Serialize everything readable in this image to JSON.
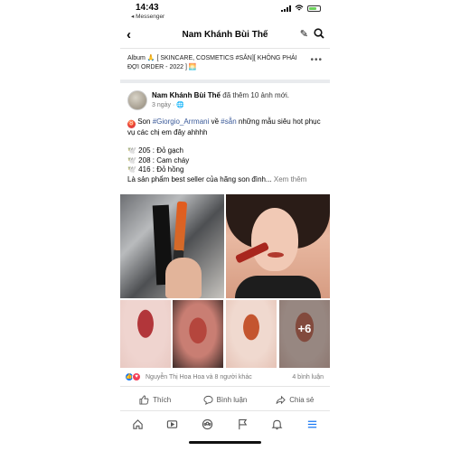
{
  "status": {
    "time": "14:43",
    "back_app": "◂ Messenger"
  },
  "topbar": {
    "title": "Nam Khánh Bùi Thế"
  },
  "album": {
    "text": "Album 🙏 [ SKINCARE, COSMETICS #SẴN][ KHÔNG PHẢI ĐỢI ORDER - 2022 ] 🌅"
  },
  "post": {
    "author": "Nam Khánh Bùi Thế",
    "action": " đã thêm 10 ảnh mới.",
    "time": "3 ngày · ",
    "line1_prefix": " Son ",
    "tag1": "#Giorgio_Arrmani",
    "line1_mid": " về ",
    "tag2": "#sẵn",
    "line1_suffix": " những mẫu siêu hot phục vụ các chị em đây ahhhh",
    "shade1": "🕊️ 205 : Đỏ gạch",
    "shade2": "🕊️ 208 : Cam cháy",
    "shade3": "🕊️ 416 : Đỏ hồng",
    "summary": "Là sản phẩm best seller của hãng son đình... ",
    "see_more": "Xem thêm",
    "more_photos": "+6"
  },
  "reactions": {
    "names": "Nguyễn Thị Hoa Hoa và 8 người khác",
    "comments": "4 bình luận"
  },
  "actions": {
    "like": "Thích",
    "comment": "Bình luận",
    "share": "Chia sẻ"
  },
  "colors": {
    "accent": "#1877f2",
    "hashtag": "#385898"
  }
}
